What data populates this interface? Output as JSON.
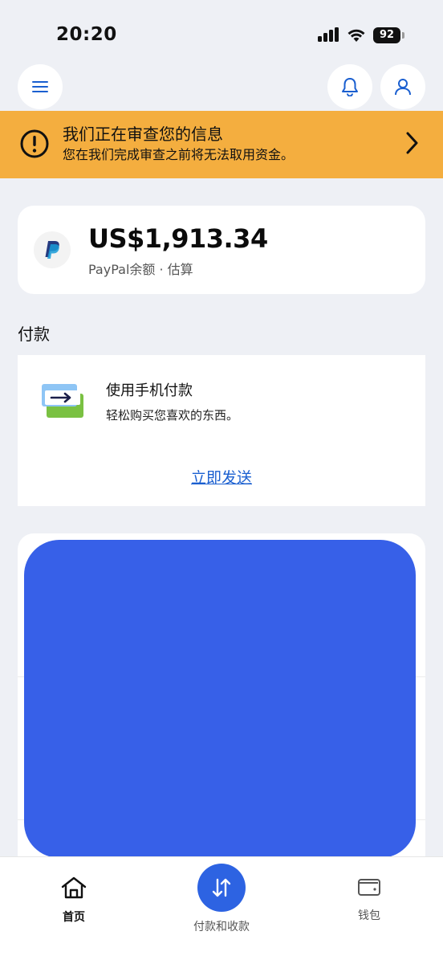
{
  "status_bar": {
    "time": "20:20",
    "battery": "92"
  },
  "top_nav": {
    "menu_icon": "hamburger-menu-icon",
    "bell_icon": "bell-icon",
    "profile_icon": "person-icon"
  },
  "alert": {
    "title": "我们正在审查您的信息",
    "subtitle": "您在我们完成审查之前将无法取用资金。",
    "color": "#f4ae3f"
  },
  "balance": {
    "amount": "US$1,913.34",
    "label": "PayPal余额 · 估算"
  },
  "payment": {
    "section_title": "付款",
    "heading": "使用手机付款",
    "description": "轻松购买您喜欢的东西。",
    "link": "立即发送"
  },
  "bottom_nav": {
    "home_label": "首页",
    "pay_label": "付款和收款",
    "wallet_label": "钱包",
    "accent": "#2d63e2"
  },
  "colors": {
    "blue_panel": "#3760e8",
    "background": "#eef0f5"
  }
}
